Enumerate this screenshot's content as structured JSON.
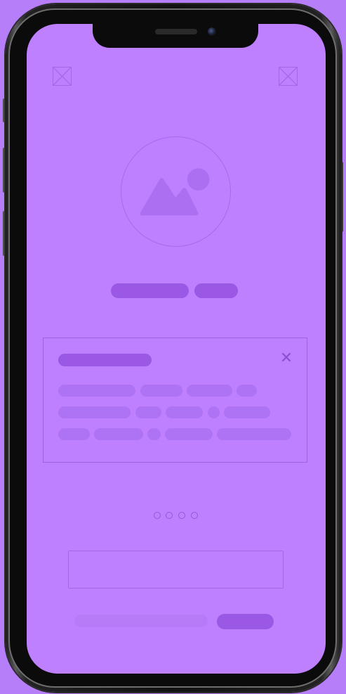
{
  "screen": {
    "background": "#bf80ff",
    "top_left_icon": "image-placeholder-icon",
    "top_right_icon": "image-placeholder-icon",
    "hero_icon": "image-icon",
    "card_close_icon": "close-icon",
    "card_close_glyph": "✕",
    "pagination": {
      "count": 4,
      "active_index": null
    }
  },
  "device": {
    "frame_color": "#111111",
    "accent_background": "#b67ef9"
  }
}
